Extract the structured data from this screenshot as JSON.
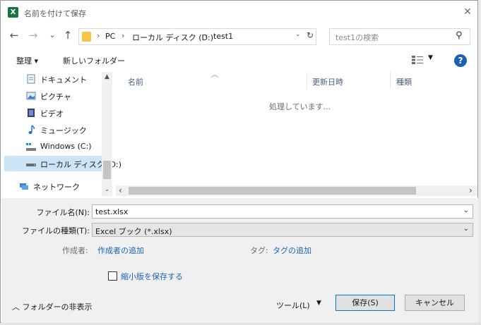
{
  "window": {
    "title": "名前を付けて保存",
    "app_icon": "X"
  },
  "nav": {
    "back_icon": "←",
    "forward_icon": "→",
    "recent_icon": "⌄",
    "up_icon": "↑",
    "breadcrumb": [
      "PC",
      "ローカル ディスク (D:)",
      "test1"
    ],
    "sep": "›",
    "search_placeholder": "test1の検索"
  },
  "toolbar": {
    "organize": "整理 ▾",
    "new_folder": "新しいフォルダー"
  },
  "sidebar": {
    "items": [
      {
        "label": "ドキュメント",
        "icon": "document-icon"
      },
      {
        "label": "ピクチャ",
        "icon": "pictures-icon"
      },
      {
        "label": "ビデオ",
        "icon": "video-icon"
      },
      {
        "label": "ミュージック",
        "icon": "music-icon"
      },
      {
        "label": "Windows (C:)",
        "icon": "drive-icon"
      },
      {
        "label": "ローカル ディスク (D:)",
        "icon": "drive-icon",
        "selected": true
      },
      {
        "label": "ネットワーク",
        "icon": "network-icon"
      }
    ]
  },
  "filelist": {
    "columns": [
      "名前",
      "更新日時",
      "種類"
    ],
    "status": "処理しています..."
  },
  "form": {
    "filename_label": "ファイル名(N):",
    "filename_value": "test.xlsx",
    "type_label": "ファイルの種類(T):",
    "type_value": "Excel ブック (*.xlsx)",
    "author_label": "作成者:",
    "author_link": "作成者の追加",
    "tags_label": "タグ:",
    "tags_link": "タグの追加",
    "thumbnail_label": "縮小版を保存する",
    "hide_folders": "フォルダーの非表示",
    "tools": "ツール(L)",
    "save": "保存(S)",
    "cancel": "キャンセル"
  },
  "colors": {
    "accent": "#0078d7",
    "link": "#1a64b4",
    "selected": "#cce4f7",
    "excel": "#1f7244"
  }
}
